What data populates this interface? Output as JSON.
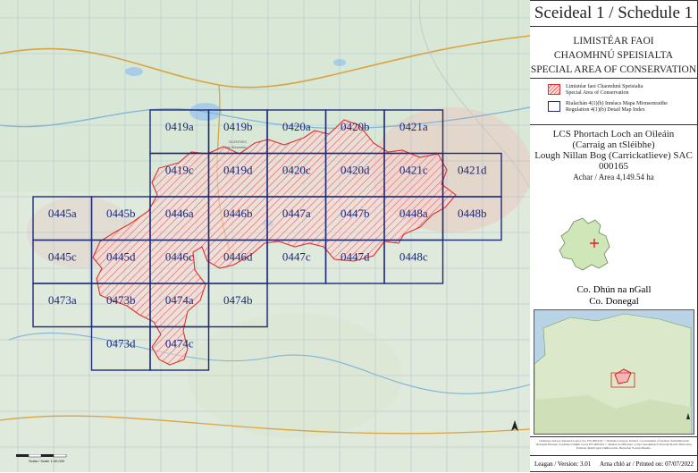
{
  "schedule_title": "Sceideal 1 / Schedule 1",
  "heading": {
    "line1": "LIMISTÉAR FAOI",
    "line2": "CHAOMHNÚ SPEISIALTA",
    "line3": "SPECIAL AREA OF CONSERVATION"
  },
  "legend": {
    "sac_line1": "Limistéar faoi Chaomhnú Speisialta",
    "sac_line2": "Special Area of Conservation",
    "index_line1": "Rialachán 4(1)(b) Innéacs Mapa Mionsonraithe",
    "index_line2": "Regulation 4(1)(b) Detail Map Index"
  },
  "site": {
    "irish_name_1": "LCS Phortach Loch an Oileáin",
    "irish_name_2": "(Carraig an tSléibhe)",
    "english_name": "Lough Nillan Bog (Carrickatlieve) SAC",
    "code": "000165",
    "area": "Achar / Area 4,149.54 ha"
  },
  "county": {
    "irish": "Co. Dhún na nGall",
    "english": "Co. Donegal"
  },
  "credits": "Ordnance Survey Ireland Licence No. EN 0004/22 © Ordnance Survey Ireland / Government of Ireland. Suirbhéireacht Ordanáis Éireann Ceadúnas Uimhir Lícne EN 0004/22 © Rialtas na hÉireann. Cóip Chonaitheach Tionóisí Roinn Tithíochta, Rialtais Áitiúil agus Oidhreachta. Bunachar Sonraí Mapála.",
  "version": "Leagan / Version: 3.01",
  "printed": "Arna chló ar / Printed on: 07/07/2022",
  "map": {
    "place_label_1": "GLENTIES",
    "place_label_2": "Na Gleanntaí",
    "scale_text": "Scála / Scale 1:40,000"
  },
  "colors": {
    "sac": "#e03030",
    "index": "#1c2a7a"
  },
  "tiles": [
    {
      "label": "0419a",
      "row": 0,
      "col": 2
    },
    {
      "label": "0419b",
      "row": 0,
      "col": 3
    },
    {
      "label": "0420a",
      "row": 0,
      "col": 4
    },
    {
      "label": "0420b",
      "row": 0,
      "col": 5
    },
    {
      "label": "0421a",
      "row": 0,
      "col": 6
    },
    {
      "label": "0419c",
      "row": 1,
      "col": 2
    },
    {
      "label": "0419d",
      "row": 1,
      "col": 3
    },
    {
      "label": "0420c",
      "row": 1,
      "col": 4
    },
    {
      "label": "0420d",
      "row": 1,
      "col": 5
    },
    {
      "label": "0421c",
      "row": 1,
      "col": 6
    },
    {
      "label": "0421d",
      "row": 1,
      "col": 7
    },
    {
      "label": "0445a",
      "row": 2,
      "col": 0
    },
    {
      "label": "0445b",
      "row": 2,
      "col": 1
    },
    {
      "label": "0446a",
      "row": 2,
      "col": 2
    },
    {
      "label": "0446b",
      "row": 2,
      "col": 3
    },
    {
      "label": "0447a",
      "row": 2,
      "col": 4
    },
    {
      "label": "0447b",
      "row": 2,
      "col": 5
    },
    {
      "label": "0448a",
      "row": 2,
      "col": 6
    },
    {
      "label": "0448b",
      "row": 2,
      "col": 7
    },
    {
      "label": "0445c",
      "row": 3,
      "col": 0
    },
    {
      "label": "0445d",
      "row": 3,
      "col": 1
    },
    {
      "label": "0446c",
      "row": 3,
      "col": 2
    },
    {
      "label": "0446d",
      "row": 3,
      "col": 3
    },
    {
      "label": "0447c",
      "row": 3,
      "col": 4
    },
    {
      "label": "0447d",
      "row": 3,
      "col": 5
    },
    {
      "label": "0448c",
      "row": 3,
      "col": 6
    },
    {
      "label": "0473a",
      "row": 4,
      "col": 0
    },
    {
      "label": "0473b",
      "row": 4,
      "col": 1
    },
    {
      "label": "0474a",
      "row": 4,
      "col": 2
    },
    {
      "label": "0474b",
      "row": 4,
      "col": 3
    },
    {
      "label": "0473d",
      "row": 5,
      "col": 1
    },
    {
      "label": "0474c",
      "row": 5,
      "col": 2
    }
  ]
}
